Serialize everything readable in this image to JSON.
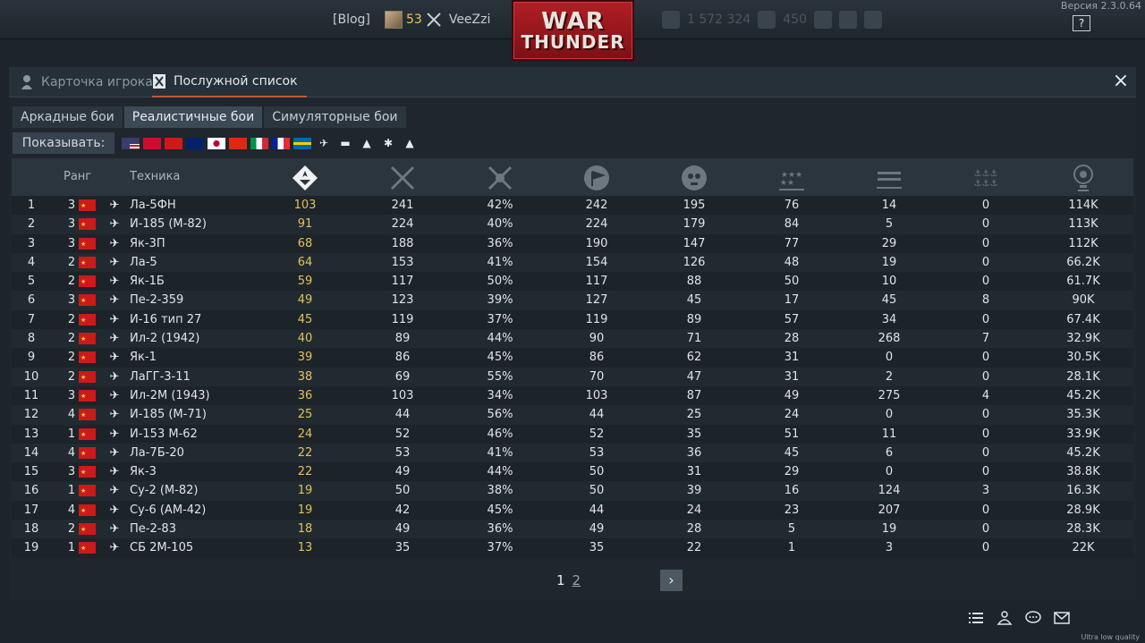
{
  "topbar": {
    "blog": "[Blog]",
    "level": "53",
    "nick": "VeeZzi",
    "currency": [
      "1 572 324",
      "450"
    ],
    "version": "Версия 2.3.0.64",
    "help": "?"
  },
  "logo": {
    "line1": "WAR",
    "line2": "THUNDER"
  },
  "dialog": {
    "tabs": [
      "Карточка игрока",
      "Послужной список"
    ],
    "close": "×",
    "mode_tabs": [
      "Аркадные бои",
      "Реалистичные бои",
      "Симуляторные бои"
    ],
    "active_mode": "Реалистичные бои",
    "show_label": "Показывать:",
    "columns": {
      "rank": "Ранг",
      "vehicle": "Техника"
    }
  },
  "colors": {
    "gold": "#e2c25a",
    "accent": "#c05a3a",
    "flag_red": "#cc1a1a"
  },
  "rows": [
    {
      "i": "1",
      "r": "3",
      "name": "Ла-5ФН",
      "v": [
        "103",
        "241",
        "42%",
        "242",
        "195",
        "76",
        "14",
        "0",
        "114K"
      ]
    },
    {
      "i": "2",
      "r": "3",
      "name": "И-185 (М-82)",
      "v": [
        "91",
        "224",
        "40%",
        "224",
        "179",
        "84",
        "5",
        "0",
        "113K"
      ]
    },
    {
      "i": "3",
      "r": "3",
      "name": "Як-3П",
      "v": [
        "68",
        "188",
        "36%",
        "190",
        "147",
        "77",
        "29",
        "0",
        "112K"
      ]
    },
    {
      "i": "4",
      "r": "2",
      "name": "Ла-5",
      "v": [
        "64",
        "153",
        "41%",
        "154",
        "126",
        "48",
        "19",
        "0",
        "66.2K"
      ]
    },
    {
      "i": "5",
      "r": "2",
      "name": "Як-1Б",
      "v": [
        "59",
        "117",
        "50%",
        "117",
        "88",
        "50",
        "10",
        "0",
        "61.7K"
      ]
    },
    {
      "i": "6",
      "r": "3",
      "name": "Пе-2-359",
      "v": [
        "49",
        "123",
        "39%",
        "127",
        "45",
        "17",
        "45",
        "8",
        "90K"
      ]
    },
    {
      "i": "7",
      "r": "2",
      "name": "И-16 тип 27",
      "v": [
        "45",
        "119",
        "37%",
        "119",
        "89",
        "57",
        "34",
        "0",
        "67.4K"
      ]
    },
    {
      "i": "8",
      "r": "2",
      "name": "Ил-2 (1942)",
      "v": [
        "40",
        "89",
        "44%",
        "90",
        "71",
        "28",
        "268",
        "7",
        "32.9K"
      ]
    },
    {
      "i": "9",
      "r": "2",
      "name": "Як-1",
      "v": [
        "39",
        "86",
        "45%",
        "86",
        "62",
        "31",
        "0",
        "0",
        "30.5K"
      ]
    },
    {
      "i": "10",
      "r": "2",
      "name": "ЛаГГ-3-11",
      "v": [
        "38",
        "69",
        "55%",
        "70",
        "47",
        "31",
        "2",
        "0",
        "28.1K"
      ]
    },
    {
      "i": "11",
      "r": "3",
      "name": "Ил-2М (1943)",
      "v": [
        "36",
        "103",
        "34%",
        "103",
        "87",
        "49",
        "275",
        "4",
        "45.2K"
      ]
    },
    {
      "i": "12",
      "r": "4",
      "name": "И-185 (М-71)",
      "v": [
        "25",
        "44",
        "56%",
        "44",
        "25",
        "24",
        "0",
        "0",
        "35.3K"
      ]
    },
    {
      "i": "13",
      "r": "1",
      "name": "И-153 М-62",
      "v": [
        "24",
        "52",
        "46%",
        "52",
        "35",
        "51",
        "11",
        "0",
        "33.9K"
      ]
    },
    {
      "i": "14",
      "r": "4",
      "name": "Ла-7Б-20",
      "v": [
        "22",
        "53",
        "41%",
        "53",
        "36",
        "45",
        "6",
        "0",
        "45.2K"
      ]
    },
    {
      "i": "15",
      "r": "3",
      "name": "Як-3",
      "v": [
        "22",
        "49",
        "44%",
        "50",
        "31",
        "29",
        "0",
        "0",
        "38.8K"
      ]
    },
    {
      "i": "16",
      "r": "1",
      "name": "Су-2 (М-82)",
      "v": [
        "19",
        "50",
        "38%",
        "50",
        "39",
        "16",
        "124",
        "3",
        "16.3K"
      ]
    },
    {
      "i": "17",
      "r": "4",
      "name": "Су-6 (АМ-42)",
      "v": [
        "19",
        "42",
        "45%",
        "44",
        "24",
        "23",
        "207",
        "0",
        "28.9K"
      ]
    },
    {
      "i": "18",
      "r": "2",
      "name": "Пе-2-83",
      "v": [
        "18",
        "49",
        "36%",
        "49",
        "28",
        "5",
        "19",
        "0",
        "28.3K"
      ]
    },
    {
      "i": "19",
      "r": "1",
      "name": "СБ 2М-105",
      "v": [
        "13",
        "35",
        "37%",
        "35",
        "22",
        "1",
        "3",
        "0",
        "22K"
      ]
    }
  ],
  "pagination": {
    "page1": "1",
    "page2": "2",
    "next": "›"
  },
  "quality": "Ultra low quality"
}
